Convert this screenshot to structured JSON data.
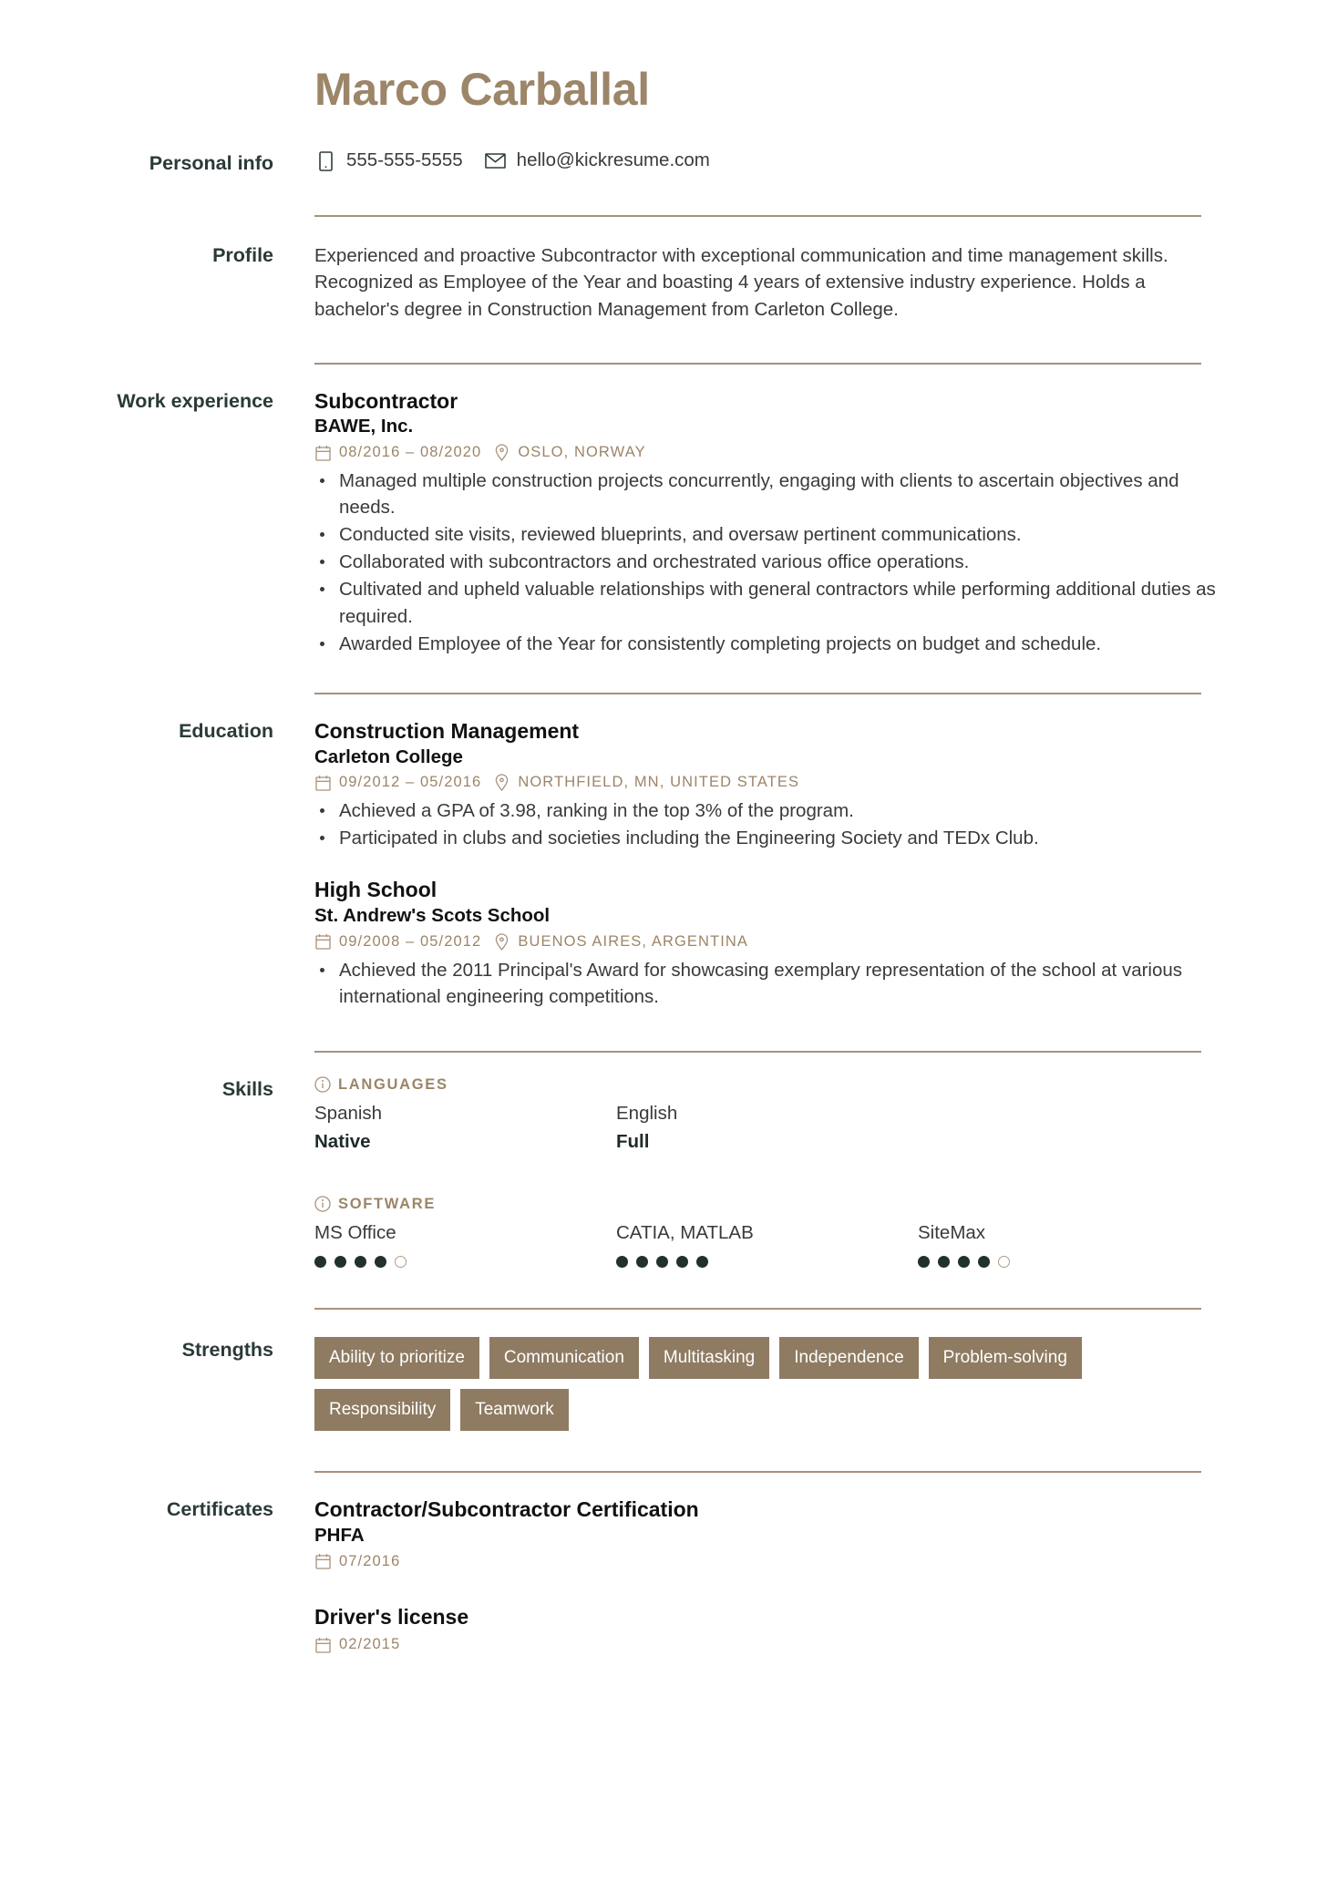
{
  "colors": {
    "accent": "#9c8568",
    "rule": "#a8917a",
    "tag_bg": "#8e7b62",
    "side_label": "#2a3a38",
    "heading": "#111111",
    "body": "#3a3a3a",
    "dot_filled": "#22302e"
  },
  "header": {
    "name": "Marco Carballal"
  },
  "personal_info": {
    "label": "Personal info",
    "phone": "555-555-5555",
    "email": "hello@kickresume.com",
    "phone_icon": "phone-icon",
    "email_icon": "envelope-icon"
  },
  "profile": {
    "label": "Profile",
    "text": "Experienced and proactive Subcontractor with exceptional communication and time management skills. Recognized as Employee of the Year and boasting 4 years of extensive industry experience. Holds a bachelor's degree in Construction Management from Carleton College."
  },
  "work_experience": {
    "label": "Work experience",
    "entries": [
      {
        "title": "Subcontractor",
        "company": "BAWE, Inc.",
        "dates": "08/2016 – 08/2020",
        "location": "OSLO, NORWAY",
        "bullets": [
          "Managed multiple construction projects concurrently, engaging with clients to ascertain objectives and needs.",
          "Conducted site visits, reviewed blueprints, and oversaw pertinent communications.",
          "Collaborated with subcontractors and orchestrated various office operations.",
          "Cultivated and upheld valuable relationships with general contractors while performing additional duties as required.",
          "Awarded Employee of the Year for consistently completing projects on budget and schedule."
        ]
      }
    ]
  },
  "education": {
    "label": "Education",
    "entries": [
      {
        "title": "Construction Management",
        "school": "Carleton College",
        "dates": "09/2012 – 05/2016",
        "location": "NORTHFIELD, MN, UNITED STATES",
        "bullets": [
          "Achieved a GPA of 3.98, ranking in the top 3% of the program.",
          "Participated in clubs and societies including the Engineering Society and TEDx Club."
        ]
      },
      {
        "title": "High School",
        "school": "St. Andrew's Scots School",
        "dates": "09/2008 – 05/2012",
        "location": "BUENOS AIRES, ARGENTINA",
        "bullets": [
          "Achieved the 2011 Principal's Award for showcasing exemplary representation of the school at various international engineering competitions."
        ]
      }
    ]
  },
  "skills": {
    "label": "Skills",
    "languages": {
      "group_label": "LANGUAGES",
      "items": [
        {
          "name": "Spanish",
          "level": "Native"
        },
        {
          "name": "English",
          "level": "Full"
        }
      ]
    },
    "software": {
      "group_label": "SOFTWARE",
      "max_dots": 5,
      "items": [
        {
          "name": "MS Office",
          "rating": 4
        },
        {
          "name": "CATIA, MATLAB",
          "rating": 5
        },
        {
          "name": "SiteMax",
          "rating": 4
        }
      ]
    }
  },
  "strengths": {
    "label": "Strengths",
    "tags": [
      "Ability to prioritize",
      "Communication",
      "Multitasking",
      "Independence",
      "Problem-solving",
      "Responsibility",
      "Teamwork"
    ]
  },
  "certificates": {
    "label": "Certificates",
    "entries": [
      {
        "title": "Contractor/Subcontractor Certification",
        "issuer": "PHFA",
        "date": "07/2016"
      },
      {
        "title": "Driver's license",
        "issuer": "",
        "date": "02/2015"
      }
    ]
  }
}
